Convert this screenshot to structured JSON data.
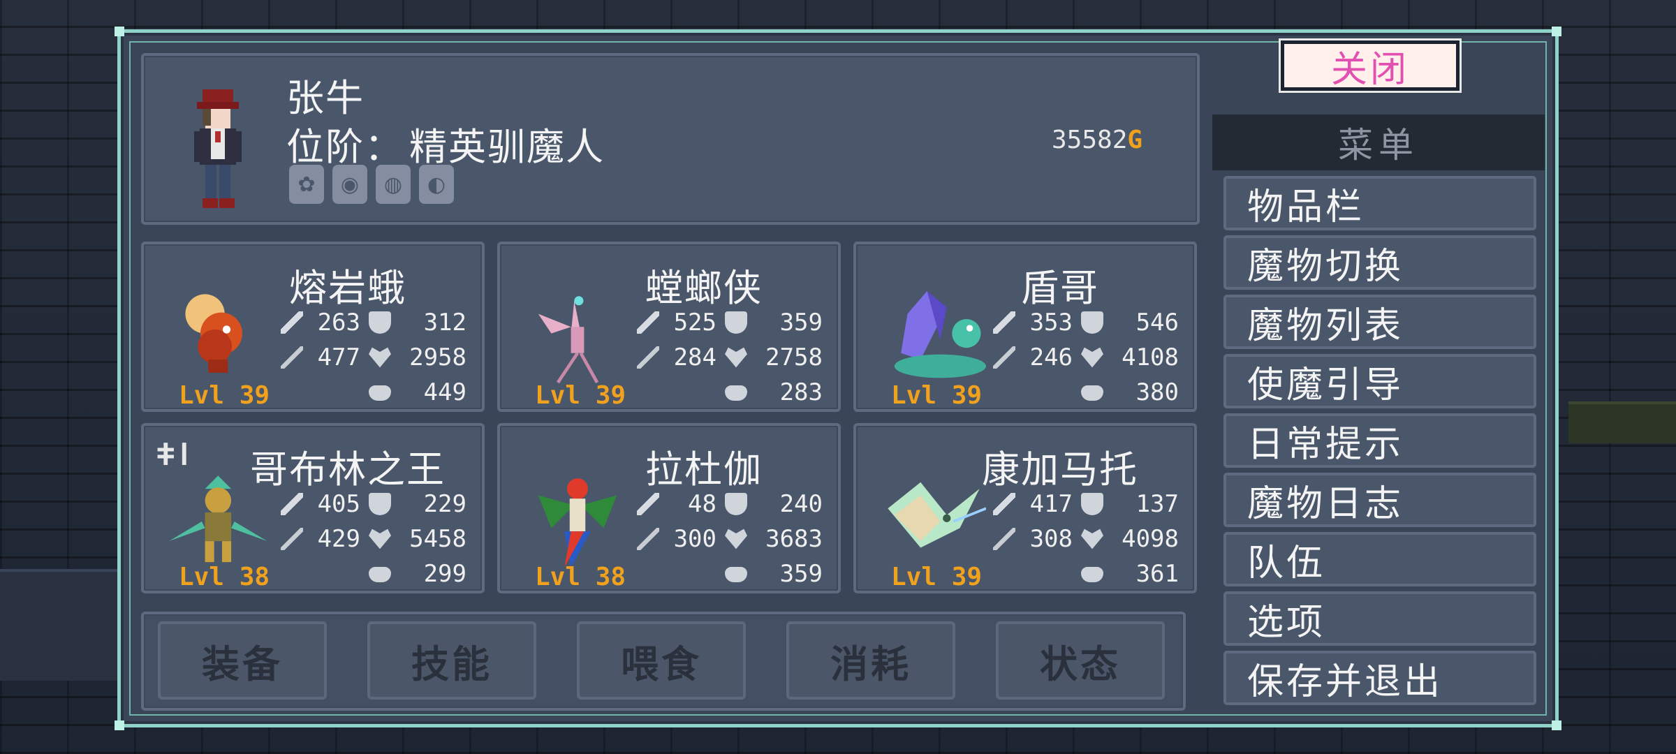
{
  "player": {
    "name": "张牛",
    "rank_label": "位阶：",
    "rank_value": "精英驯魔人",
    "gold_amount": "35582",
    "gold_unit": "G",
    "badges": [
      "✿",
      "◉",
      "◍",
      "◐"
    ]
  },
  "monsters": [
    {
      "name": "熔岩蛾",
      "level": "Lvl 39",
      "atk": "263",
      "def": "312",
      "mag": "477",
      "hp": "2958",
      "food": "449",
      "sprite": "lava-moth",
      "tier": ""
    },
    {
      "name": "螳螂侠",
      "level": "Lvl 39",
      "atk": "525",
      "def": "359",
      "mag": "284",
      "hp": "2758",
      "food": "283",
      "sprite": "mantis",
      "tier": ""
    },
    {
      "name": "盾哥",
      "level": "Lvl 39",
      "atk": "353",
      "def": "546",
      "mag": "246",
      "hp": "4108",
      "food": "380",
      "sprite": "crystal-snail",
      "tier": ""
    },
    {
      "name": "哥布林之王",
      "level": "Lvl 38",
      "atk": "405",
      "def": "229",
      "mag": "429",
      "hp": "5458",
      "food": "299",
      "sprite": "goblin-king",
      "tier": "ǂǀ"
    },
    {
      "name": "拉杜伽",
      "level": "Lvl 38",
      "atk": "48",
      "def": "240",
      "mag": "300",
      "hp": "3683",
      "food": "359",
      "sprite": "parrot",
      "tier": ""
    },
    {
      "name": "康加马托",
      "level": "Lvl 39",
      "atk": "417",
      "def": "137",
      "mag": "308",
      "hp": "4098",
      "food": "361",
      "sprite": "manta",
      "tier": ""
    }
  ],
  "tabs": [
    "装备",
    "技能",
    "喂食",
    "消耗",
    "状态"
  ],
  "menu": {
    "close_label": "关闭",
    "title": "菜单",
    "items": [
      "物品栏",
      "魔物切换",
      "魔物列表",
      "使魔引导",
      "日常提示",
      "魔物日志",
      "队伍",
      "选项",
      "保存并退出"
    ]
  },
  "colors": {
    "accent_gold": "#f0a11e",
    "frame_teal": "#8fd3c8",
    "close_pink": "#e14fb0",
    "panel": "#4a5669"
  }
}
